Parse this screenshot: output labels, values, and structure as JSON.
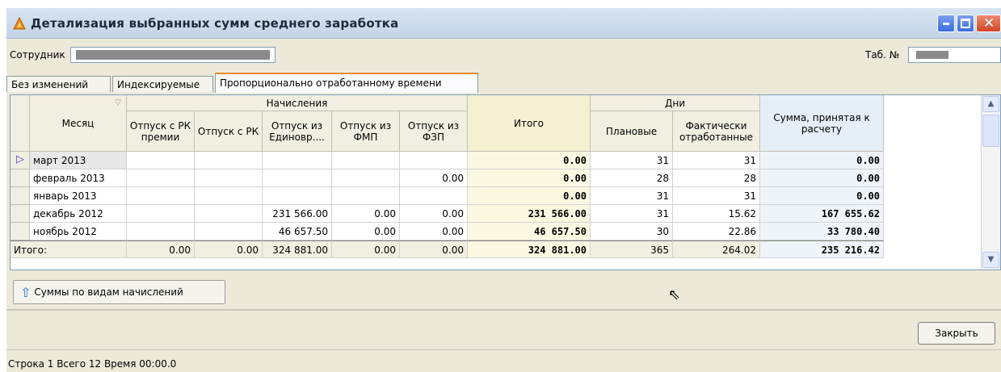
{
  "window": {
    "title": "Детализация выбранных сумм среднего заработка"
  },
  "employee": {
    "label": "Сотрудник",
    "value": "",
    "tab_label": "Таб. №",
    "tab_value": ""
  },
  "tabs": [
    {
      "label": "Без изменений"
    },
    {
      "label": "Индексируемые"
    },
    {
      "label": "Пропорционально отработанному времени"
    }
  ],
  "grid": {
    "headers": {
      "month": "Месяц",
      "accruals_group": "Начисления",
      "otp_rk_prem": "Отпуск с РК премии",
      "otp_rk": "Отпуск с РК",
      "otp_edin": "Отпуск из Единовр....",
      "otp_fmp": "Отпуск из ФМП",
      "otp_fzp": "Отпуск из ФЗП",
      "itogo": "Итого",
      "days_group": "Дни",
      "planned": "Плановые",
      "actual": "Фактически отработанные",
      "sum_accepted": "Сумма, принятая к расчету"
    },
    "rows": [
      {
        "month": "март 2013",
        "c1": "",
        "c2": "",
        "c3": "",
        "c4": "",
        "c5": "",
        "itogo": "0.00",
        "plan": "31",
        "fact": "31",
        "sum": "0.00"
      },
      {
        "month": "февраль 2013",
        "c1": "",
        "c2": "",
        "c3": "",
        "c4": "",
        "c5": "0.00",
        "itogo": "0.00",
        "plan": "28",
        "fact": "28",
        "sum": "0.00"
      },
      {
        "month": "январь 2013",
        "c1": "",
        "c2": "",
        "c3": "",
        "c4": "",
        "c5": "",
        "itogo": "0.00",
        "plan": "31",
        "fact": "31",
        "sum": "0.00"
      },
      {
        "month": "декабрь 2012",
        "c1": "",
        "c2": "",
        "c3": "231 566.00",
        "c4": "0.00",
        "c5": "0.00",
        "itogo": "231 566.00",
        "plan": "31",
        "fact": "15.62",
        "sum": "167 655.62"
      },
      {
        "month": "ноябрь 2012",
        "c1": "",
        "c2": "",
        "c3": "46 657.50",
        "c4": "0.00",
        "c5": "0.00",
        "itogo": "46 657.50",
        "plan": "30",
        "fact": "22.86",
        "sum": "33 780.40"
      }
    ],
    "total": {
      "month": "Итого:",
      "c1": "0.00",
      "c2": "0.00",
      "c3": "324 881.00",
      "c4": "0.00",
      "c5": "0.00",
      "itogo": "324 881.00",
      "plan": "365",
      "fact": "264.02",
      "sum": "235 216.42"
    }
  },
  "toolbar": {
    "sums_button": "Суммы по видам начислений"
  },
  "footer": {
    "close_button": "Закрыть",
    "status": "Строка 1 Всего 12 Время 00:00.0"
  }
}
